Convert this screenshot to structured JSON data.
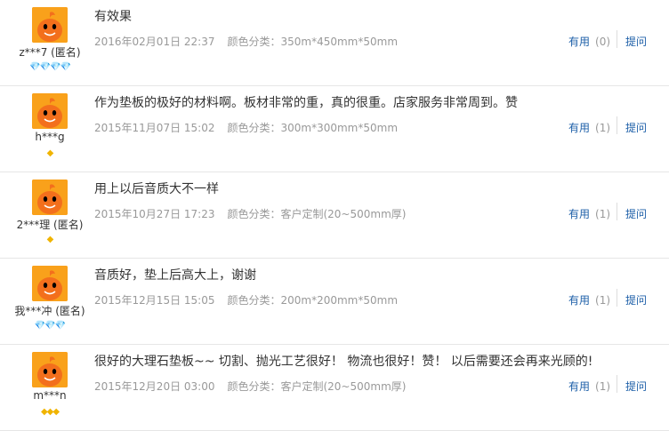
{
  "reviews": [
    {
      "user": "z***7 (匿名)",
      "badges": "💎💎💎💎",
      "badge_color": "red",
      "content": "有效果",
      "date": "2016年02月01日 22:37",
      "spec": "颜色分类：350m*450mm*50mm",
      "useful_label": "有用",
      "useful_count": "(0)",
      "reply_label": "提问"
    },
    {
      "user": "h***g",
      "badges": "◆",
      "badge_color": "gold",
      "content": "作为垫板的极好的材料啊。板材非常的重，真的很重。店家服务非常周到。赞",
      "date": "2015年11月07日 15:02",
      "spec": "颜色分类：300m*300mm*50mm",
      "useful_label": "有用",
      "useful_count": "(1)",
      "reply_label": "提问"
    },
    {
      "user": "2***理 (匿名)",
      "badges": "◆",
      "badge_color": "gold",
      "content": "用上以后音质大不一样",
      "date": "2015年10月27日 17:23",
      "spec": "颜色分类：客户定制(20~500mm厚)",
      "useful_label": "有用",
      "useful_count": "(1)",
      "reply_label": "提问"
    },
    {
      "user": "我***冲 (匿名)",
      "badges": "💎💎💎",
      "badge_color": "red",
      "content": "音质好，垫上后高大上，谢谢",
      "date": "2015年12月15日 15:05",
      "spec": "颜色分类：200m*200mm*50mm",
      "useful_label": "有用",
      "useful_count": "(1)",
      "reply_label": "提问"
    },
    {
      "user": "m***n",
      "badges": "◆◆◆",
      "badge_color": "gold",
      "content": "很好的大理石垫板~~ 切割、抛光工艺很好！ 物流也很好！赞！ 以后需要还会再来光顾的!",
      "date": "2015年12月20日 03:00",
      "spec": "颜色分类：客户定制(20~500mm厚)",
      "useful_label": "有用",
      "useful_count": "(1)",
      "reply_label": "提问"
    }
  ]
}
